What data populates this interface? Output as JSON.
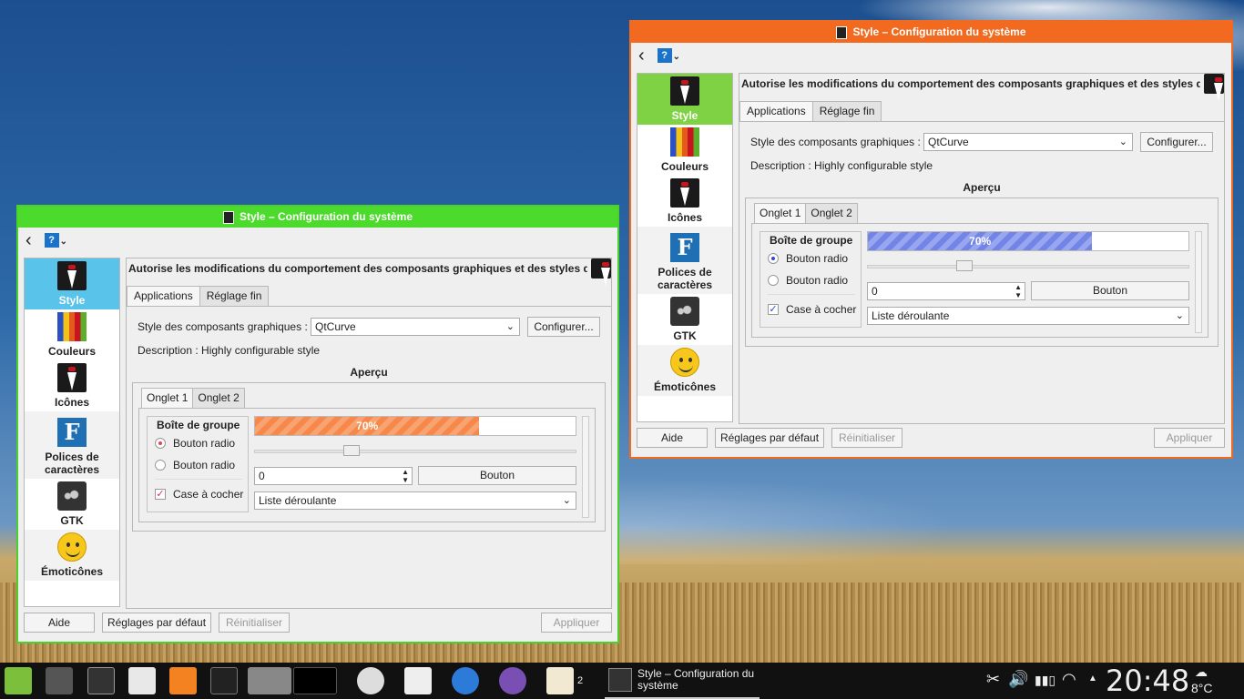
{
  "window_title": "Style – Configuration du système",
  "help_label": "?",
  "sidebar": [
    {
      "label": "Style",
      "icon": "style-icon"
    },
    {
      "label": "Couleurs",
      "icon": "colors-icon"
    },
    {
      "label": "Icônes",
      "icon": "icons-icon"
    },
    {
      "label": "Polices de caractères",
      "icon": "fonts-icon"
    },
    {
      "label": "GTK",
      "icon": "gtk-icon"
    },
    {
      "label": "Émoticônes",
      "icon": "emoticons-icon"
    }
  ],
  "module_description": "Autorise les modifications du comportement des composants graphiques et des styles de K",
  "tabs": [
    "Applications",
    "Réglage fin"
  ],
  "widget_style": {
    "label": "Style des composants graphiques :",
    "value": "QtCurve",
    "configure_label": "Configurer..."
  },
  "description_line": "Description : Highly configurable style",
  "preview": {
    "title": "Aperçu",
    "tabs": [
      "Onglet 1",
      "Onglet 2"
    ],
    "groupbox_title": "Boîte de groupe",
    "radio1": "Bouton radio",
    "radio2": "Bouton radio",
    "checkbox": "Case à cocher",
    "progress": 70,
    "progress_text": "70%",
    "slider_value": 0.3,
    "spin_value": "0",
    "button_label": "Bouton",
    "combo_value": "Liste déroulante"
  },
  "buttons": {
    "help": "Aide",
    "defaults": "Réglages par défaut",
    "reset": "Réinitialiser",
    "apply": "Appliquer"
  },
  "colors": {
    "left_window_accent": "#4cdb2c",
    "left_selection": "#59c3ea",
    "left_progress": "#f7884a",
    "right_window_accent": "#f26a1f",
    "right_selection": "#7fd243",
    "right_progress": "#7284e6"
  },
  "taskbar": {
    "task_label": "Style – Configuration du système",
    "badge": "2",
    "clock": "20:48",
    "temperature": "8°C",
    "launchers": [
      "mint-menu-icon",
      "file-manager-icon",
      "window-icon",
      "text-editor-icon",
      "rss-icon",
      "workspace-icon",
      "pager-icon",
      "pager-icon",
      "disk-icon",
      "camera-icon",
      "browser-icon",
      "account-icon",
      "notes-icon"
    ],
    "tray": [
      "scissors-icon",
      "volume-icon",
      "battery-icon",
      "wifi-icon",
      "tray-arrow-icon",
      "weather-icon"
    ]
  }
}
